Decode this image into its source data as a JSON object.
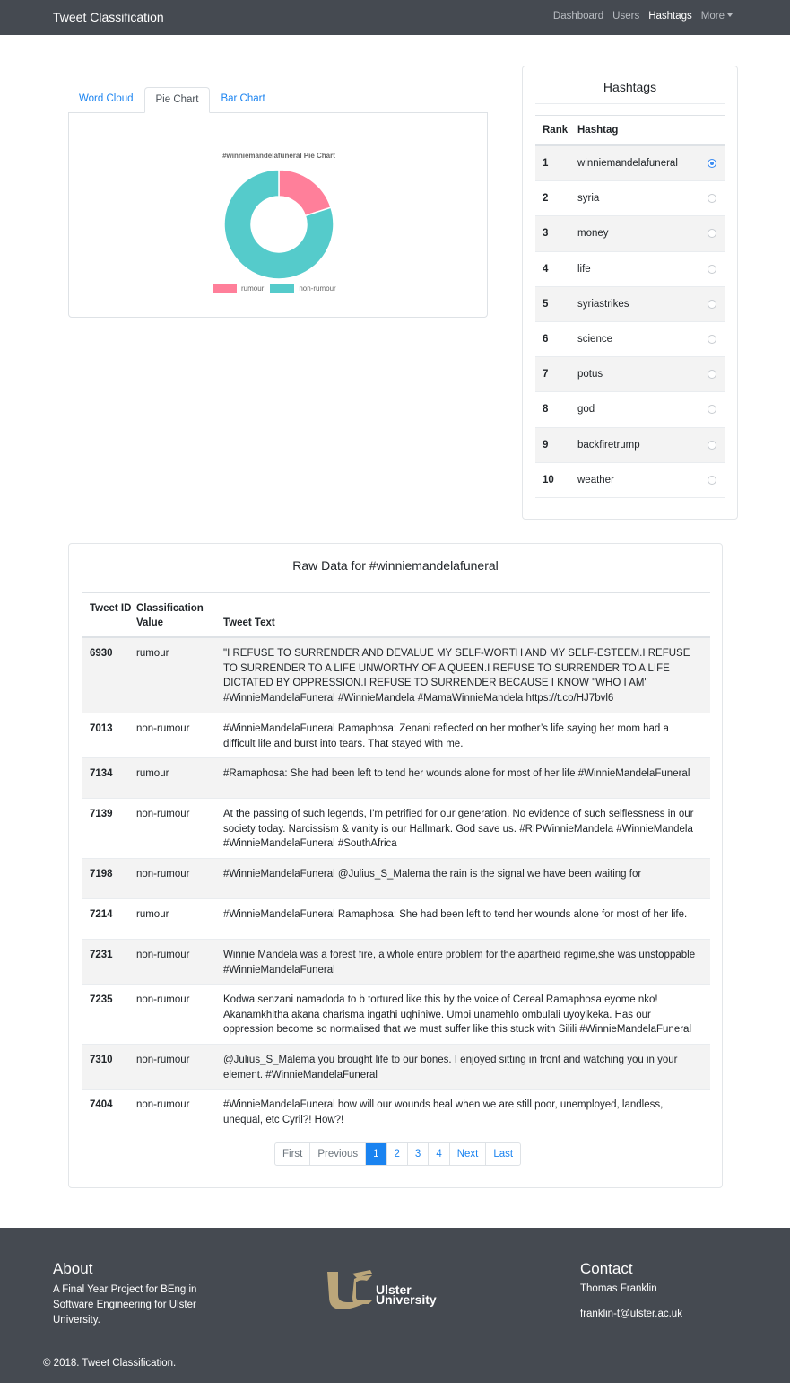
{
  "navbar": {
    "brand": "Tweet Classification",
    "links": [
      "Dashboard",
      "Users",
      "Hashtags",
      "More"
    ]
  },
  "tabs": [
    "Word Cloud",
    "Pie Chart",
    "Bar Chart"
  ],
  "chart_data": {
    "type": "pie",
    "title": "#winniemandelafuneral Pie Chart",
    "categories": [
      "rumour",
      "non-rumour"
    ],
    "values": [
      20,
      80
    ],
    "colors": [
      "#ff7f9a",
      "#55cbcb"
    ],
    "legend_position": "bottom"
  },
  "hashtags": {
    "title": "Hashtags",
    "columns": [
      "Rank",
      "Hashtag"
    ],
    "rows": [
      {
        "rank": "1",
        "tag": "winniemandelafuneral"
      },
      {
        "rank": "2",
        "tag": "syria"
      },
      {
        "rank": "3",
        "tag": "money"
      },
      {
        "rank": "4",
        "tag": "life"
      },
      {
        "rank": "5",
        "tag": "syriastrikes"
      },
      {
        "rank": "6",
        "tag": "science"
      },
      {
        "rank": "7",
        "tag": "potus"
      },
      {
        "rank": "8",
        "tag": "god"
      },
      {
        "rank": "9",
        "tag": "backfiretrump"
      },
      {
        "rank": "10",
        "tag": "weather"
      }
    ],
    "selected": "1"
  },
  "raw": {
    "title": "Raw Data for #winniemandelafuneral",
    "columns": [
      "Tweet ID",
      "Classification Value",
      "Tweet Text"
    ],
    "rows": [
      {
        "id": "6930",
        "cls": "rumour",
        "text": "\"I REFUSE TO SURRENDER AND DEVALUE MY SELF-WORTH AND MY SELF-ESTEEM.I REFUSE TO SURRENDER TO A LIFE UNWORTHY OF A QUEEN.I REFUSE TO SURRENDER TO A LIFE DICTATED BY OPPRESSION.I REFUSE TO SURRENDER BECAUSE I KNOW \"WHO I AM\" #WinnieMandelaFuneral #WinnieMandela #MamaWinnieMandela https://t.co/HJ7bvl6"
      },
      {
        "id": "7013",
        "cls": "non-rumour",
        "text": "#WinnieMandelaFuneral Ramaphosa: Zenani reflected on her mother’s life saying her mom had a difficult life and burst into tears. That stayed with me."
      },
      {
        "id": "7134",
        "cls": "rumour",
        "text": "#Ramaphosa: She had been left to tend her wounds alone for most of her life #WinnieMandelaFuneral"
      },
      {
        "id": "7139",
        "cls": "non-rumour",
        "text": "At the passing of such legends, I'm petrified for our generation. No evidence of such selflessness in our society today. Narcissism & vanity is our Hallmark. God save us. #RIPWinnieMandela #WinnieMandela #WinnieMandelaFuneral #SouthAfrica"
      },
      {
        "id": "7198",
        "cls": "non-rumour",
        "text": "#WinnieMandelaFuneral @Julius_S_Malema the rain is the signal we have been waiting for"
      },
      {
        "id": "7214",
        "cls": "rumour",
        "text": "#WinnieMandelaFuneral Ramaphosa: She had been left to tend her wounds alone for most of her life."
      },
      {
        "id": "7231",
        "cls": "non-rumour",
        "text": "Winnie Mandela was a forest fire, a whole entire problem for the apartheid regime,she was unstoppable #WinnieMandelaFuneral"
      },
      {
        "id": "7235",
        "cls": "non-rumour",
        "text": "Kodwa senzani namadoda to b tortured like this by the voice of Cereal Ramaphosa eyome nko! Akanamkhitha akana charisma ingathi uqhiniwe. Umbi unamehlo ombulali uyoyikeka. Has our oppression become so normalised that we must suffer like this stuck with Silili #WinnieMandelaFuneral"
      },
      {
        "id": "7310",
        "cls": "non-rumour",
        "text": "@Julius_S_Malema you brought life to our bones. I enjoyed sitting in front and watching you in your element. #WinnieMandelaFuneral"
      },
      {
        "id": "7404",
        "cls": "non-rumour",
        "text": "#WinnieMandelaFuneral how will our wounds heal when we are still poor, unemployed, landless, unequal, etc Cyril?! How?!"
      }
    ]
  },
  "pagination": [
    "First",
    "Previous",
    "1",
    "2",
    "3",
    "4",
    "Next",
    "Last"
  ],
  "footer": {
    "about_title": "About",
    "about_text": "A Final Year Project for BEng in Software Engineering for Ulster University.",
    "logo_text_1": "Ulster",
    "logo_text_2": "University",
    "contact_title": "Contact",
    "contact_name": "Thomas Franklin",
    "contact_email": "franklin-t@ulster.ac.uk",
    "copyright": "© 2018. Tweet Classification."
  }
}
